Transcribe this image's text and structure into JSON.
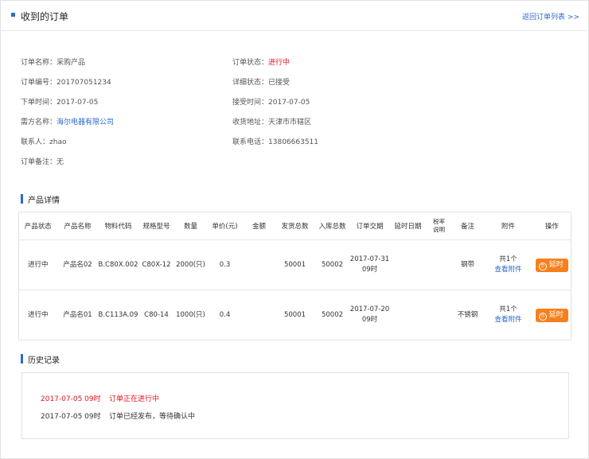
{
  "header": {
    "title": "收到的订单",
    "back_link": "返回订单列表 >>"
  },
  "order_info": {
    "left": [
      {
        "label": "订单名称：",
        "value": "采购产品"
      },
      {
        "label": "订单编号：",
        "value": "201707051234"
      },
      {
        "label": "下单时间：",
        "value": "2017-07-05"
      },
      {
        "label": "需方名称：",
        "value": "海尔电器有限公司"
      },
      {
        "label": "联系人：",
        "value": "zhao"
      },
      {
        "label": "订单备注：",
        "value": "无"
      }
    ],
    "right": [
      {
        "label": "订单状态：",
        "value": "进行中"
      },
      {
        "label": "详细状态：",
        "value": "已接受"
      },
      {
        "label": "接受时间：",
        "value": "2017-07-05"
      },
      {
        "label": "收货地址：",
        "value": "天津市市辖区"
      },
      {
        "label": "联系电话：",
        "value": "13806663511"
      }
    ]
  },
  "product_section": {
    "title": "产品详情",
    "headers": [
      "产品状态",
      "产品名称",
      "物料代码",
      "规格型号",
      "数量",
      "单价(元)",
      "金额",
      "发货总数",
      "入库总数",
      "订单交期",
      "延时日期",
      "税率说明",
      "备注",
      "附件",
      "操作"
    ],
    "rows": [
      {
        "status": "进行中",
        "name": "产品名02",
        "code": "B.C80X.002",
        "spec": "C80X-12",
        "qty": "2000(只)",
        "price": "0.3",
        "amount": "",
        "shipped": "50001",
        "stored": "50002",
        "delivery_date": "2017-07-31",
        "delivery_time": "09时",
        "delay_date": "",
        "tax": "",
        "remark": "钢带",
        "attach_count": "共1个",
        "attach_link": "查看附件",
        "action": "延时"
      },
      {
        "status": "进行中",
        "name": "产品名01",
        "code": "B.C113A.09",
        "spec": "C80-14",
        "qty": "1000(只)",
        "price": "0.4",
        "amount": "",
        "shipped": "50001",
        "stored": "50002",
        "delivery_date": "2017-07-20",
        "delivery_time": "09时",
        "delay_date": "",
        "tax": "",
        "remark": "不锈钢",
        "attach_count": "共1个",
        "attach_link": "查看附件",
        "action": "延时"
      }
    ]
  },
  "history_section": {
    "title": "历史记录",
    "entries": [
      {
        "time": "2017-07-05 09时",
        "text": "订单正在进行中"
      },
      {
        "time": "2017-07-05 09时",
        "text": "订单已经发布，等待确认中"
      }
    ]
  },
  "colors": {
    "accent": "#2d6bc9",
    "status_red": "#e0141e",
    "action_orange": "#f6801e"
  }
}
